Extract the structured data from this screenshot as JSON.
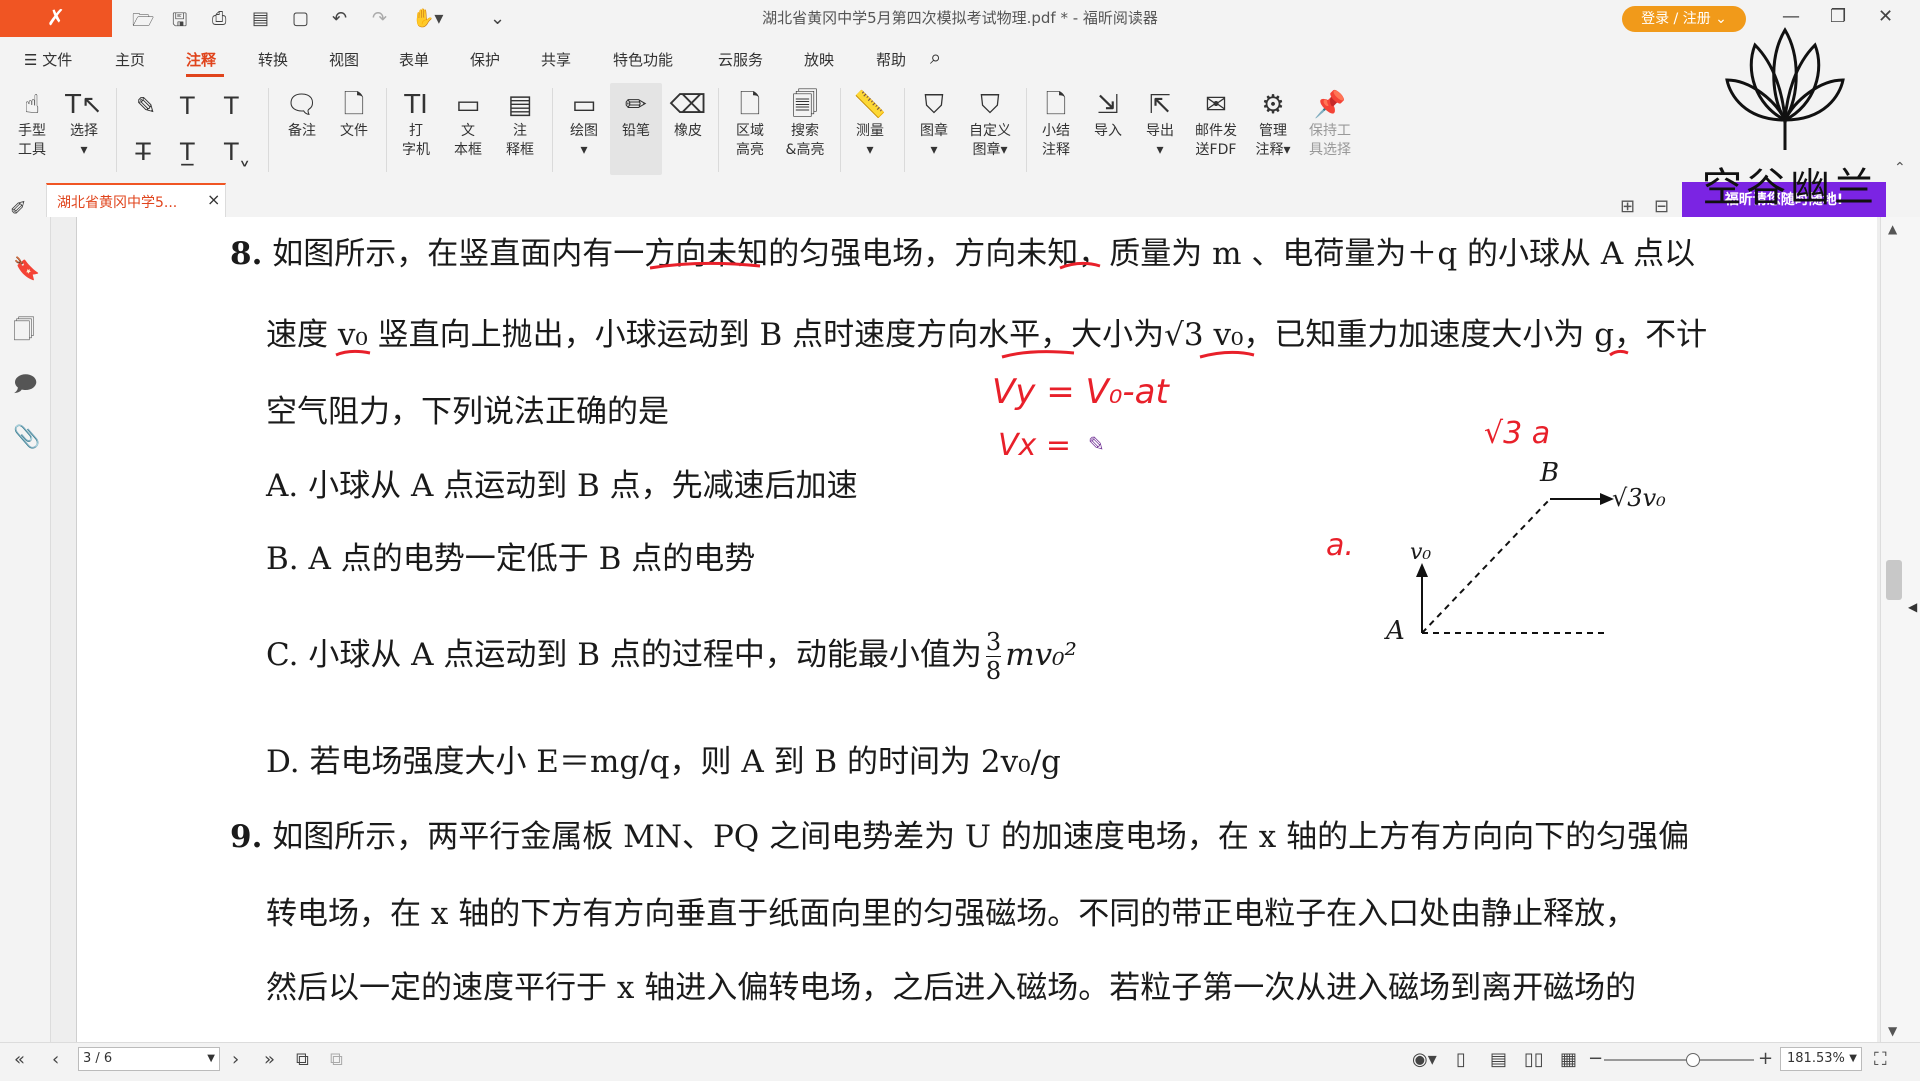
{
  "app": {
    "logo_glyph": "✗",
    "window_title": "湖北省黄冈中学5月第四次模拟考试物理.pdf * - 福昕阅读器",
    "login_label": "登录 / 注册"
  },
  "menu": {
    "file": "☰ 文件",
    "items": [
      "主页",
      "注释",
      "转换",
      "视图",
      "表单",
      "保护",
      "共享",
      "特色功能",
      "云服务",
      "放映",
      "帮助"
    ],
    "active": "注释"
  },
  "ribbon": {
    "hand": [
      "手型",
      "工具"
    ],
    "select": [
      "选择"
    ],
    "note": "备注",
    "file": "文件",
    "typewriter": [
      "打",
      "字机"
    ],
    "textbox": [
      "文",
      "本框"
    ],
    "callout": [
      "注",
      "释框"
    ],
    "drawing": "绘图",
    "pencil": "铅笔",
    "eraser": "橡皮",
    "area_highlight": [
      "区域",
      "高亮"
    ],
    "search_highlight": [
      "搜索",
      "&高亮"
    ],
    "measure": "测量",
    "stamp": "图章",
    "custom_stamp": [
      "自定义",
      "图章▾"
    ],
    "summarize": [
      "小结",
      "注释"
    ],
    "import": "导入",
    "export": "导出",
    "email": [
      "邮件发",
      "送FDF"
    ],
    "manage": [
      "管理",
      "注释▾"
    ],
    "keep_tool": [
      "保持工",
      "具选择"
    ]
  },
  "doc_tab": {
    "label": "湖北省黄冈中学5...",
    "close": "×"
  },
  "document": {
    "q8": {
      "number": "8.",
      "line1": "如图所示，在竖直面内有一方向未知的匀强电场，方向未知，质量为 m 、电荷量为＋q 的小球从 A 点以",
      "line2": "速度 v₀ 竖直向上抛出，小球运动到 B 点时速度方向水平，大小为√3 v₀，已知重力加速度大小为 g，不计",
      "line3": "空气阻力，下列说法正确的是",
      "optA": "A. 小球从 A 点运动到 B 点，先减速后加速",
      "optB": "B. A 点的电势一定低于 B 点的电势",
      "optC_pre": "C. 小球从 A 点运动到 B 点的过程中，动能最小值为",
      "optC_num": "3",
      "optC_den": "8",
      "optC_post": "mv₀²",
      "optD": "D. 若电场强度大小 E＝mg/q，则 A 到 B 的时间为 2v₀/g",
      "figure": {
        "label_B": "B",
        "label_A": "A",
        "label_v0": "v₀",
        "label_vB": "√3v₀"
      }
    },
    "q9": {
      "number": "9.",
      "line1": "如图所示，两平行金属板 MN、PQ 之间电势差为 U 的加速度电场，在 x 轴的上方有方向向下的匀强偏",
      "line2": "转电场，在 x 轴的下方有方向垂直于纸面向里的匀强磁场。不同的带正电粒子在入口处由静止释放，",
      "line3": "然后以一定的速度平行于 x 轴进入偏转电场，之后进入磁场。若粒子第一次从进入磁场到离开磁场的"
    },
    "handwriting": {
      "vy": "Vy = V₀-at",
      "vx": "Vx =",
      "sqrt3a": "√3 a",
      "a": "a."
    },
    "ink_color": "#e8202a"
  },
  "watermark": {
    "text": "空谷幽兰",
    "banner": "福昕请您随时随地!"
  },
  "status": {
    "page": "3 / 6",
    "zoom": "181.53%"
  }
}
